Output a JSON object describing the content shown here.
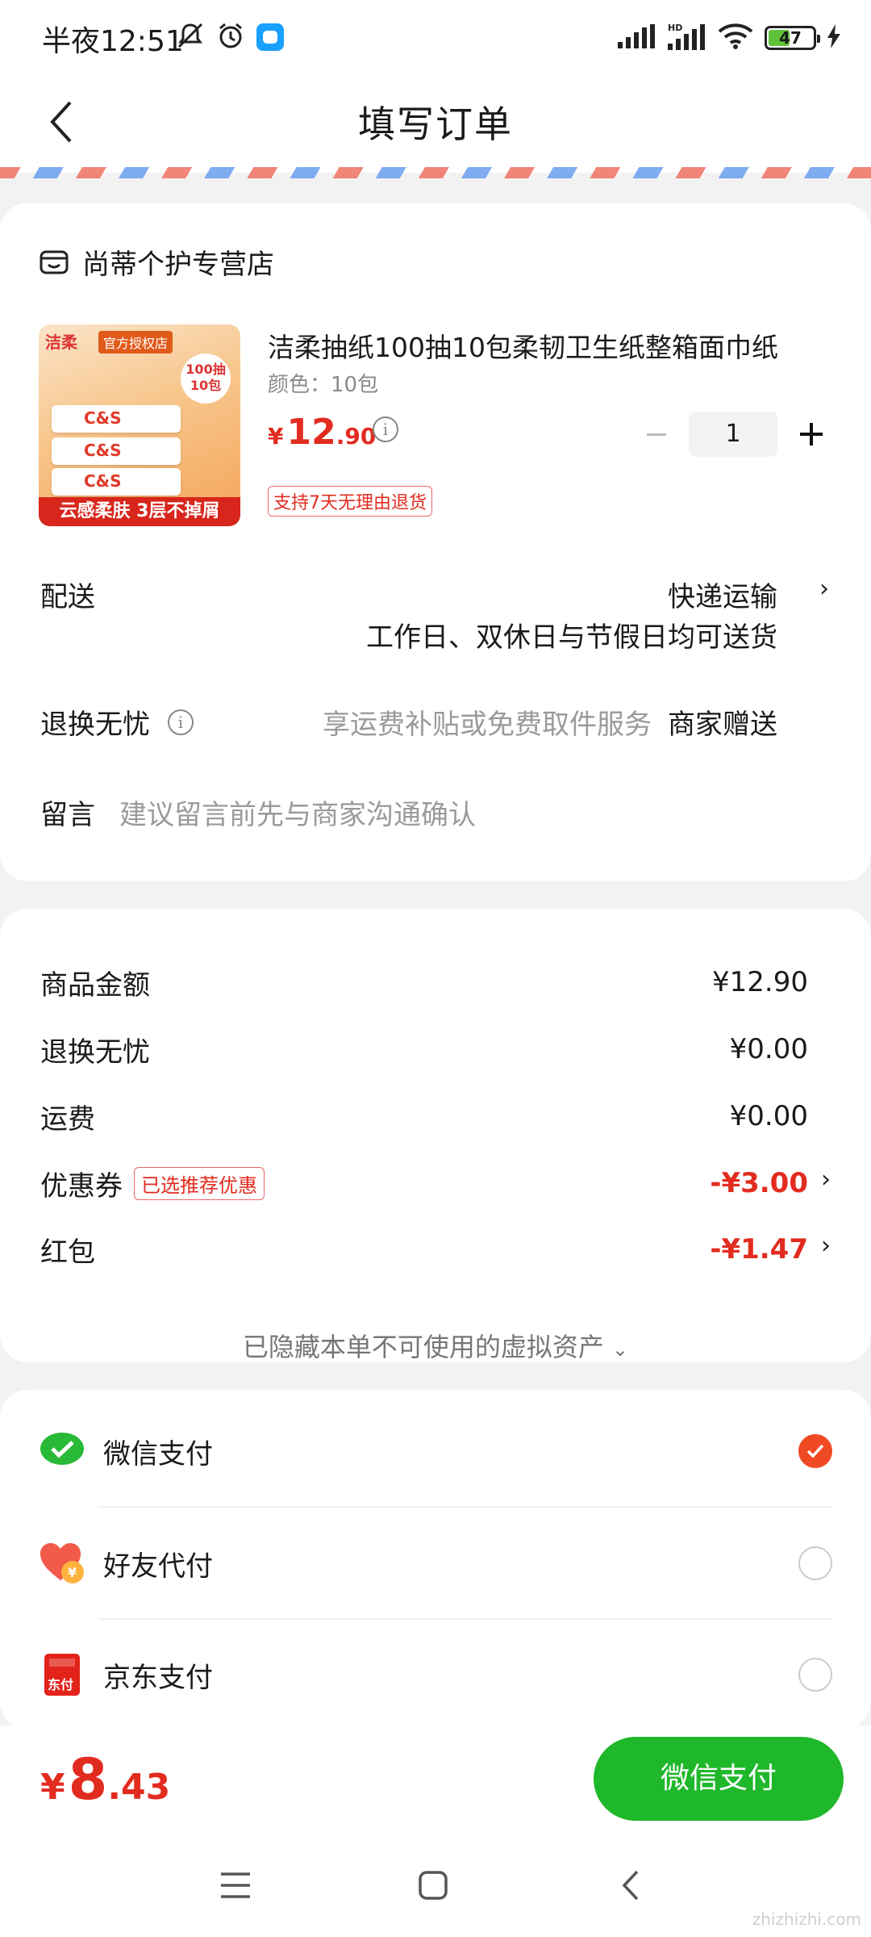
{
  "status_bar": {
    "time": "半夜12:51",
    "battery": "47"
  },
  "header": {
    "title": "填写订单"
  },
  "store": {
    "name": "尚蒂个护专营店"
  },
  "product": {
    "title": "洁柔抽纸100抽10包柔韧卫生纸整箱面巾纸",
    "spec": "颜色：10包",
    "price_currency": "¥",
    "price_int": "12",
    "price_dec": ".90",
    "quantity": "1",
    "return_tag": "支持7天无理由退货",
    "image": {
      "brand": "洁柔",
      "auth": "官方授权店",
      "badge": "100抽10包",
      "pack_label": "C&S",
      "banner": "云感柔肤 3层不掉屑"
    }
  },
  "delivery": {
    "label": "配送",
    "method": "快递运输",
    "note": "工作日、双休日与节假日均可送货"
  },
  "worry_free": {
    "label": "退换无忧",
    "hint": "享运费补贴或免费取件服务",
    "value": "商家赠送"
  },
  "message": {
    "label": "留言",
    "placeholder": "建议留言前先与商家沟通确认"
  },
  "summary": {
    "goods_label": "商品金额",
    "goods_value": "¥12.90",
    "worry_label": "退换无忧",
    "worry_value": "¥0.00",
    "shipping_label": "运费",
    "shipping_value": "¥0.00",
    "coupon_label": "优惠券",
    "coupon_tag": "已选推荐优惠",
    "coupon_value": "-¥3.00",
    "redpacket_label": "红包",
    "redpacket_value": "-¥1.47",
    "hidden_assets": "已隐藏本单不可使用的虚拟资产"
  },
  "payment": {
    "options": [
      {
        "name": "微信支付",
        "selected": true
      },
      {
        "name": "好友代付",
        "selected": false
      },
      {
        "name": "京东支付",
        "selected": false
      }
    ]
  },
  "footer": {
    "total_currency": "¥",
    "total_int": "8",
    "total_dec": ".43",
    "pay_button": "微信支付"
  },
  "watermark": "zhizhizhi.com",
  "colors": {
    "accent_red": "#e22c1f",
    "pay_green": "#1fb82b",
    "selected_orange": "#f04a24"
  }
}
